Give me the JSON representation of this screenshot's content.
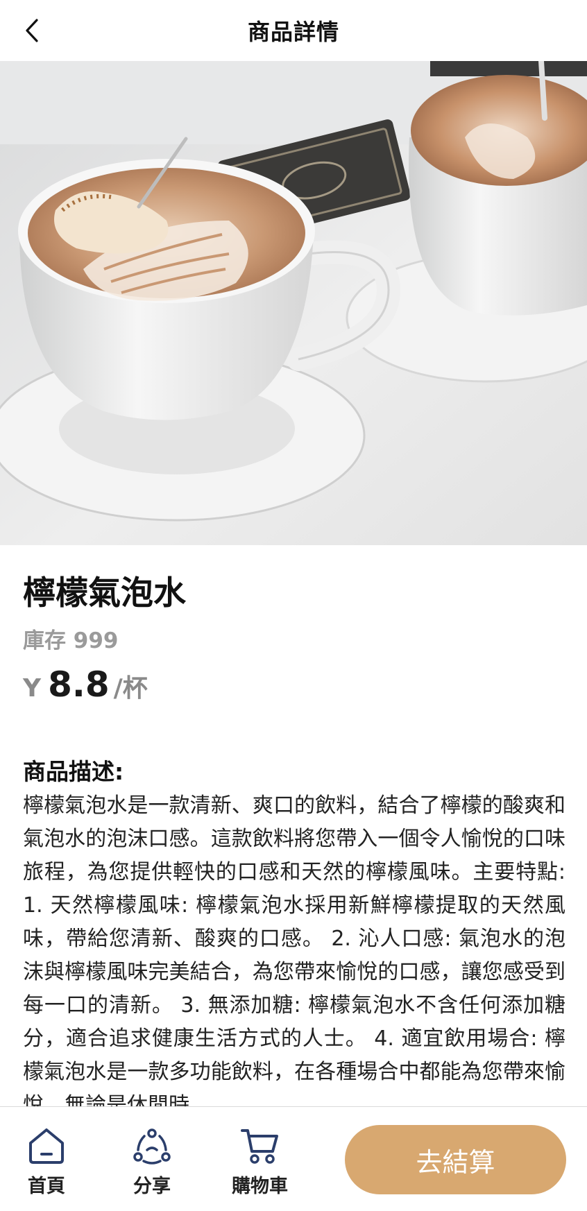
{
  "header": {
    "title": "商品詳情",
    "back_icon": "chevron-left-icon"
  },
  "hero": {
    "alt": "coffee-photo"
  },
  "product": {
    "name": "檸檬氣泡水",
    "stock_text": "庫存 999",
    "currency": "Y",
    "price": "8.8",
    "unit": "/杯"
  },
  "description": {
    "title": "商品描述:",
    "body": "檸檬氣泡水是一款清新、爽口的飲料，結合了檸檬的酸爽和氣泡水的泡沫口感。這款飲料將您帶入一個令人愉悅的口味旅程，為您提供輕快的口感和天然的檸檬風味。主要特點: 1. 天然檸檬風味: 檸檬氣泡水採用新鮮檸檬提取的天然風味，帶給您清新、酸爽的口感。 2. 沁人口感: 氣泡水的泡沫與檸檬風味完美結合，為您帶來愉悅的口感，讓您感受到每一口的清新。 3. 無添加糖: 檸檬氣泡水不含任何添加糖分，適合追求健康生活方式的人士。 4. 適宜飲用場合: 檸檬氣泡水是一款多功能飲料，在各種場合中都能為您帶來愉悅，無論是休閒時"
  },
  "bottom_nav": {
    "items": [
      {
        "label": "首頁",
        "icon": "home-icon"
      },
      {
        "label": "分享",
        "icon": "share-icon"
      },
      {
        "label": "購物車",
        "icon": "cart-icon"
      }
    ],
    "checkout_label": "去結算"
  },
  "colors": {
    "accent": "#d8a870",
    "muted": "#9a9a9a",
    "nav_icon": "#2b3e6b"
  }
}
